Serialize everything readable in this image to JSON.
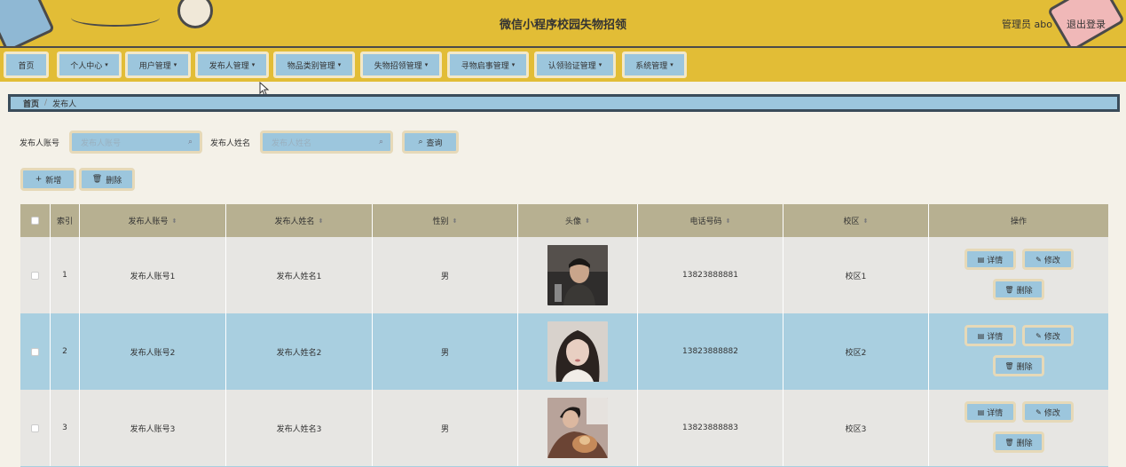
{
  "header": {
    "title": "微信小程序校园失物招领",
    "admin": "管理员 abo",
    "logout": "退出登录"
  },
  "nav": [
    {
      "label": "首页",
      "has_chevron": false
    },
    {
      "label": "个人中心",
      "has_chevron": true
    },
    {
      "label": "用户管理",
      "has_chevron": true
    },
    {
      "label": "发布人管理",
      "has_chevron": true
    },
    {
      "label": "物品类别管理",
      "has_chevron": true
    },
    {
      "label": "失物招领管理",
      "has_chevron": true
    },
    {
      "label": "寻物启事管理",
      "has_chevron": true
    },
    {
      "label": "认领验证管理",
      "has_chevron": true
    },
    {
      "label": "系统管理",
      "has_chevron": true
    }
  ],
  "breadcrumb": {
    "home": "首页",
    "separator": "/",
    "current": "发布人"
  },
  "search": {
    "account_label": "发布人账号",
    "account_placeholder": "发布人账号",
    "name_label": "发布人姓名",
    "name_placeholder": "发布人姓名",
    "query_button": "查询"
  },
  "actions": {
    "add": "新增",
    "delete": "删除"
  },
  "table": {
    "columns": [
      "索引",
      "发布人账号",
      "发布人姓名",
      "性别",
      "头像",
      "电话号码",
      "校区",
      "操作"
    ],
    "rows": [
      {
        "index": "1",
        "account": "发布人账号1",
        "name": "发布人姓名1",
        "gender": "男",
        "phone": "13823888881",
        "campus": "校区1",
        "avatar_tone": "#3d3b3a"
      },
      {
        "index": "2",
        "account": "发布人账号2",
        "name": "发布人姓名2",
        "gender": "男",
        "phone": "13823888882",
        "campus": "校区2",
        "avatar_tone": "#b9a9a4"
      },
      {
        "index": "3",
        "account": "发布人账号3",
        "name": "发布人姓名3",
        "gender": "男",
        "phone": "13823888883",
        "campus": "校区3",
        "avatar_tone": "#8a5a44"
      }
    ],
    "row_actions": {
      "detail": "详情",
      "edit": "修改",
      "delete": "删除"
    }
  },
  "colors": {
    "header_bg": "#e2bd36",
    "button_bg": "#9cc6dd",
    "table_head": "#b7b091",
    "row_alt": "#a9cfe0"
  }
}
